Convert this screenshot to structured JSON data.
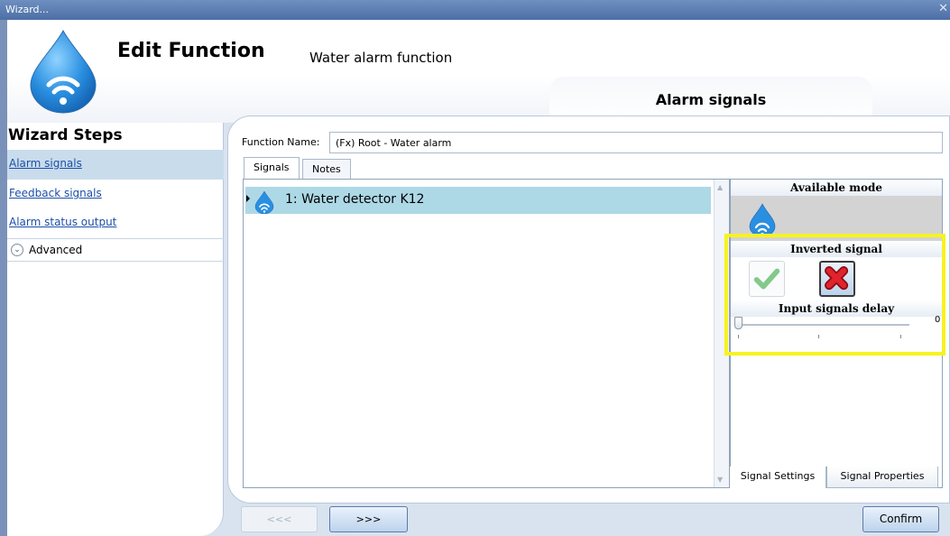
{
  "window": {
    "title": "Wizard...",
    "close_glyph": "✕"
  },
  "header": {
    "title": "Edit Function",
    "subtitle": "Water alarm function",
    "current_step": "Alarm signals",
    "icon": "water-drop-wireless-icon"
  },
  "sidebar": {
    "heading": "Wizard Steps",
    "steps": [
      {
        "label": "Alarm signals",
        "active": true
      },
      {
        "label": "Feedback signals",
        "active": false
      },
      {
        "label": "Alarm status output",
        "active": false
      }
    ],
    "advanced": {
      "label": "Advanced",
      "icon": "chevron-down-circle-icon"
    }
  },
  "form": {
    "function_name_label": "Function Name:",
    "function_name_value": "(Fx) Root - Water alarm"
  },
  "tabs": [
    {
      "label": "Signals",
      "active": true
    },
    {
      "label": "Notes",
      "active": false
    }
  ],
  "signals": [
    {
      "label": "1: Water detector K12",
      "icon": "water-drop-wireless-icon",
      "selected": true
    }
  ],
  "right_panel": {
    "available_mode_header": "Available mode",
    "inverted_signal_header": "Inverted signal",
    "inverted_options": [
      {
        "name": "check-icon",
        "selected": false
      },
      {
        "name": "cross-icon",
        "selected": true
      }
    ],
    "delay_header": "Input signals delay",
    "delay_value": "0",
    "delay_fraction": 0.0
  },
  "bottom_tabs": [
    {
      "label": "Signal Settings",
      "active": true
    },
    {
      "label": "Signal Properties",
      "active": false
    }
  ],
  "footer": {
    "prev_label": "<<<",
    "next_label": ">>>",
    "confirm_label": "Confirm"
  },
  "colors": {
    "titlebar": "#4c6fa6",
    "selection": "#add8e6",
    "highlight_box": "#f7f31e",
    "link": "#1c4fa8"
  }
}
